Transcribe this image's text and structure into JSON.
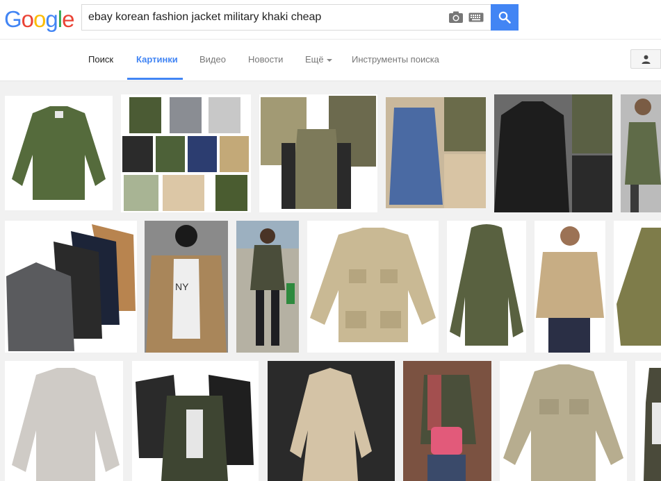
{
  "logo": {
    "letters": [
      "G",
      "o",
      "o",
      "g",
      "l",
      "e"
    ],
    "colors": [
      "#4285f4",
      "#ea4335",
      "#fbbc05",
      "#4285f4",
      "#34a853",
      "#ea4335"
    ]
  },
  "search": {
    "query": "ebay korean fashion jacket military khaki cheap"
  },
  "tabs": [
    {
      "label": "Поиск"
    },
    {
      "label": "Картинки"
    },
    {
      "label": "Видео"
    },
    {
      "label": "Новости"
    },
    {
      "label": "Ещё"
    },
    {
      "label": "Инструменты поиска"
    }
  ],
  "colors": {
    "accent": "#4285f4",
    "tab_text": "#777777",
    "background": "#f1f1f1"
  },
  "icons": {
    "search": "search-icon",
    "camera": "camera-icon",
    "keyboard": "keyboard-icon",
    "account": "person-icon"
  },
  "results": [
    {
      "id": "r1-1",
      "color": "#556b3c",
      "bg": "#ffffff"
    },
    {
      "id": "r1-2",
      "color": "#5e6b4a",
      "bg": "#ffffff"
    },
    {
      "id": "r1-3",
      "color": "#7d7a5a",
      "bg": "#ffffff"
    },
    {
      "id": "r1-4",
      "color": "#4a6aa3",
      "bg": "#c9b89c"
    },
    {
      "id": "r1-5",
      "color": "#1d1d1d",
      "bg": "#6a6a6a"
    },
    {
      "id": "r1-6",
      "color": "#5f6b48",
      "bg": "#bbbbbb"
    },
    {
      "id": "r2-1",
      "color": "#3a3f4a",
      "bg": "#ffffff"
    },
    {
      "id": "r2-2",
      "color": "#a9865a",
      "bg": "#8a8a8a"
    },
    {
      "id": "r2-3",
      "color": "#4a4d3a",
      "bg": "#b5b1a3"
    },
    {
      "id": "r2-4",
      "color": "#c9b994",
      "bg": "#ffffff"
    },
    {
      "id": "r2-5",
      "color": "#596140",
      "bg": "#ffffff"
    },
    {
      "id": "r2-6",
      "color": "#c7ad84",
      "bg": "#ffffff"
    },
    {
      "id": "r2-7",
      "color": "#7e7c4a",
      "bg": "#ffffff"
    },
    {
      "id": "r3-1",
      "color": "#cfcbc6",
      "bg": "#ffffff"
    },
    {
      "id": "r3-2",
      "color": "#3e4532",
      "bg": "#ffffff"
    },
    {
      "id": "r3-3",
      "color": "#d4c3a6",
      "bg": "#2a2a2a"
    },
    {
      "id": "r3-4",
      "color": "#e25a7a",
      "bg": "#6a4a3a"
    },
    {
      "id": "r3-5",
      "color": "#b7ad8f",
      "bg": "#ffffff"
    },
    {
      "id": "r3-6",
      "color": "#4a4a3a",
      "bg": "#ffffff"
    }
  ]
}
